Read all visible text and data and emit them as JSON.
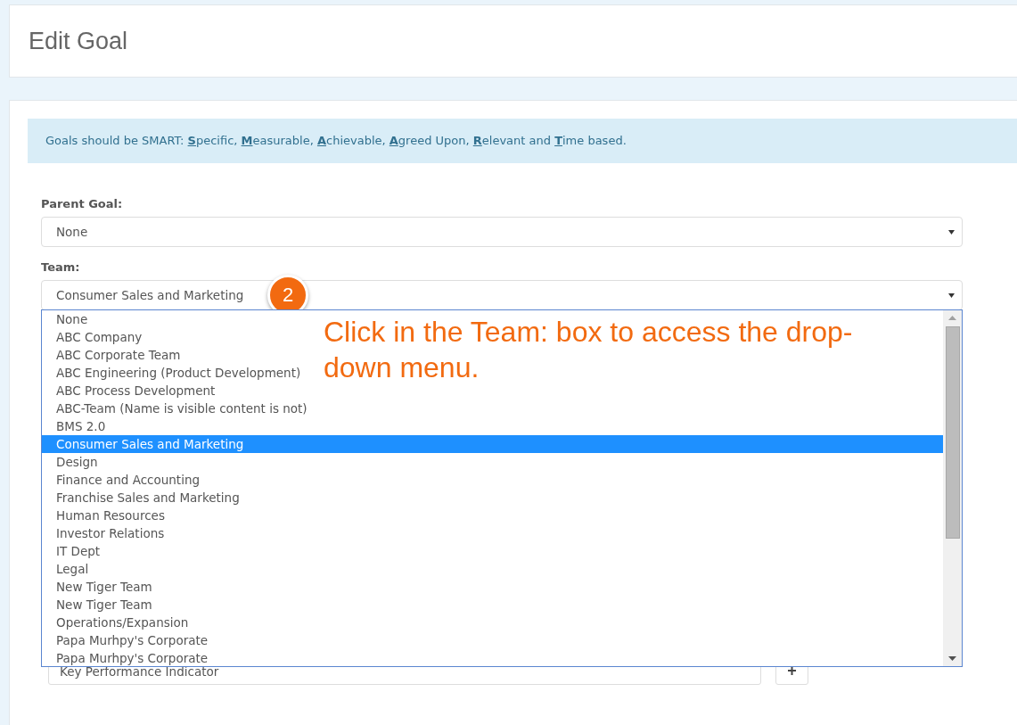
{
  "page": {
    "title": "Edit Goal"
  },
  "alert": {
    "text": "Goals should be SMART: **S**pecific, **M**easurable, **A**chievable, **A**greed Upon, **R**elevant and **T**ime based."
  },
  "parent_goal": {
    "label": "Parent Goal:",
    "value": "None"
  },
  "team": {
    "label": "Team:",
    "value": "Consumer Sales and Marketing",
    "expanded": true,
    "options": [
      {
        "label": "None",
        "selected": false
      },
      {
        "label": "ABC Company",
        "selected": false
      },
      {
        "label": "ABC Corporate Team",
        "selected": false
      },
      {
        "label": "ABC Engineering (Product Development)",
        "selected": false
      },
      {
        "label": "ABC Process Development",
        "selected": false
      },
      {
        "label": "ABC-Team (Name is visible content is not)",
        "selected": false
      },
      {
        "label": "BMS 2.0",
        "selected": false
      },
      {
        "label": "Consumer Sales and Marketing",
        "selected": true
      },
      {
        "label": "Design",
        "selected": false
      },
      {
        "label": "Finance and Accounting",
        "selected": false
      },
      {
        "label": "Franchise Sales and Marketing",
        "selected": false
      },
      {
        "label": "Human Resources",
        "selected": false
      },
      {
        "label": "Investor Relations",
        "selected": false
      },
      {
        "label": "IT Dept",
        "selected": false
      },
      {
        "label": "Legal",
        "selected": false
      },
      {
        "label": "New Tiger Team",
        "selected": false
      },
      {
        "label": "New Tiger Team",
        "selected": false
      },
      {
        "label": "Operations/Expansion",
        "selected": false
      },
      {
        "label": "Papa Murhpy's Corporate",
        "selected": false
      },
      {
        "label": "Papa Murhpy's Corporate",
        "selected": false
      }
    ]
  },
  "kpi": {
    "placeholder": "Key Performance Indicator",
    "add_button": "+"
  },
  "callout": {
    "step": "2",
    "text": "Click in the Team: box to access the drop-down menu."
  }
}
